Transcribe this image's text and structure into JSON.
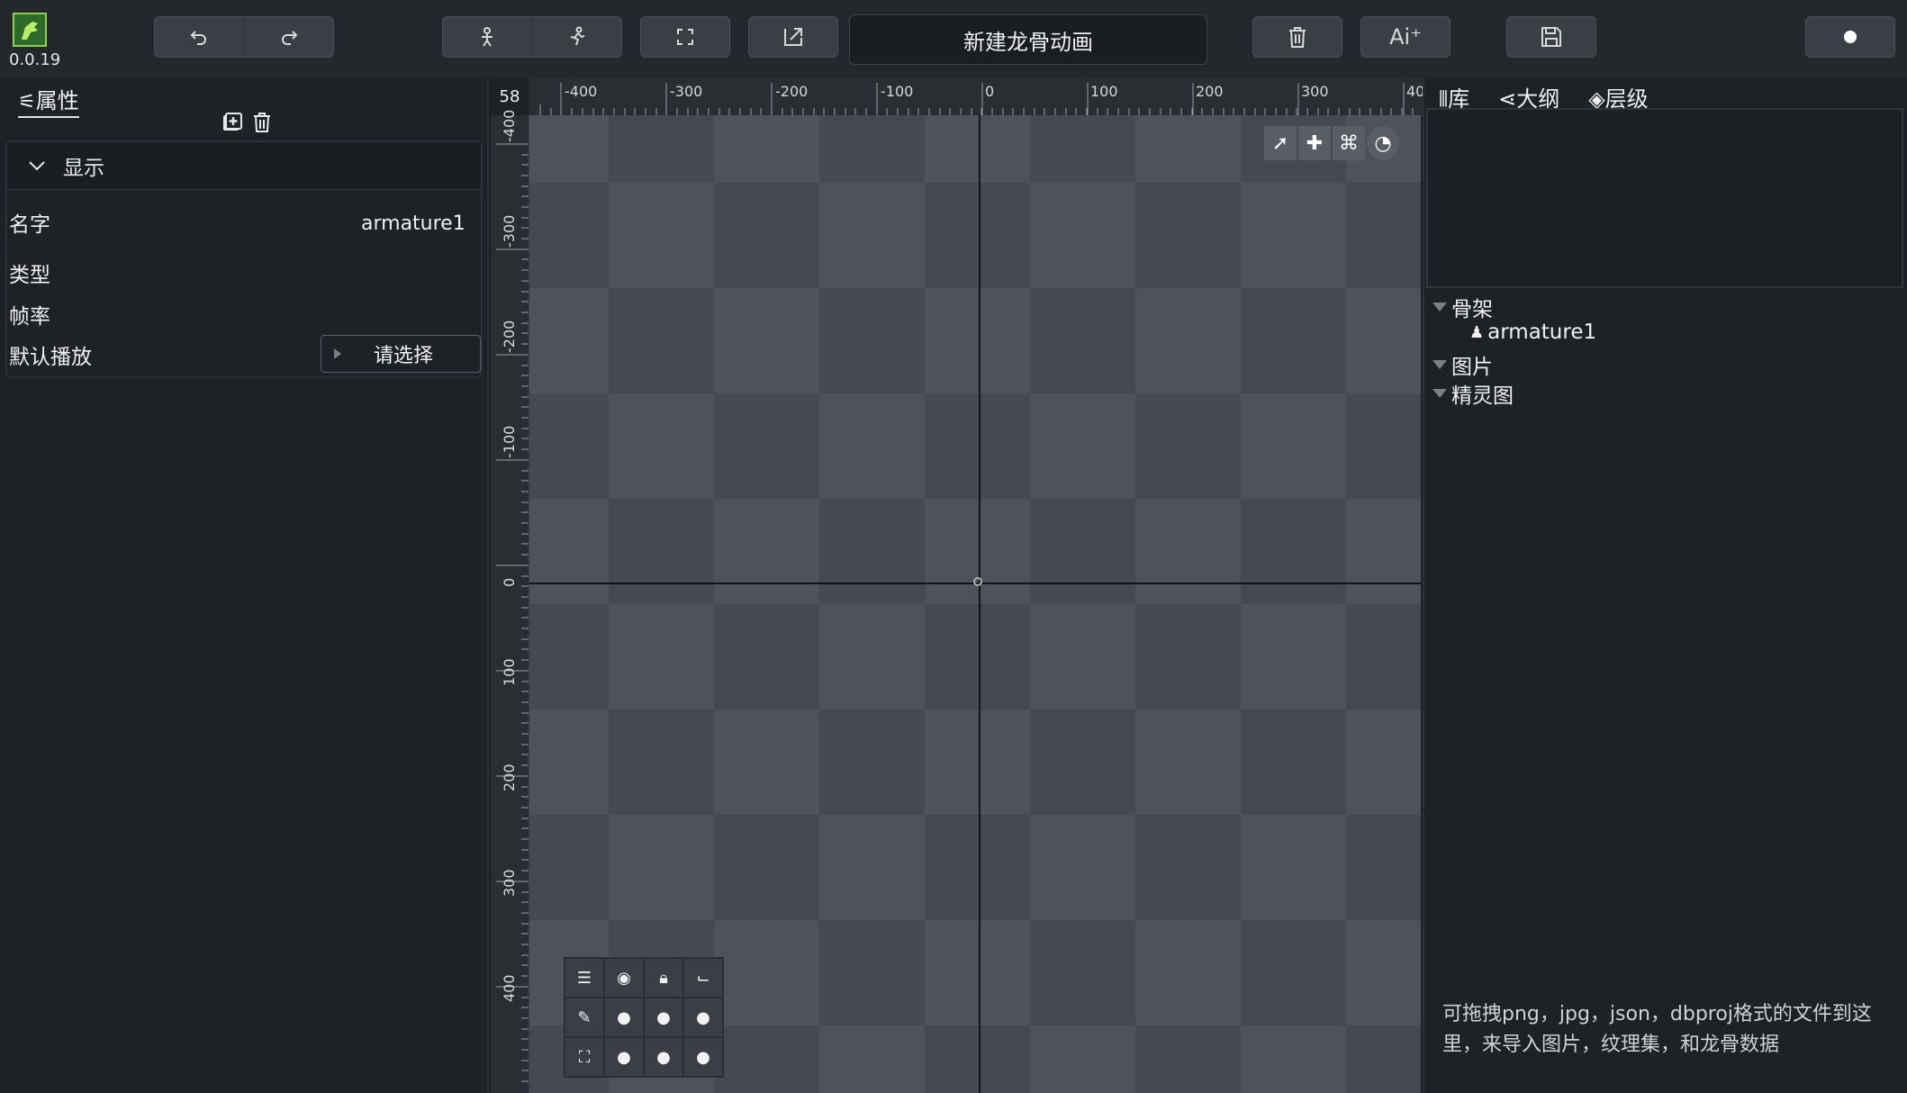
{
  "app": {
    "version": "0.0.19",
    "title": "新建龙骨动画"
  },
  "toolbar": {
    "undo_icon": "undo-icon",
    "redo_icon": "redo-icon",
    "pose_icon": "armature-pose-icon",
    "animate_icon": "run-icon",
    "fit_icon": "fullscreen-icon",
    "export_icon": "export-icon",
    "delete_icon": "trash-icon",
    "ai_label": "Ai⁺",
    "save_icon": "save-icon"
  },
  "left_panel": {
    "tab_label": "属性",
    "section_title": "显示",
    "props": [
      {
        "label": "名字",
        "value": "armature1"
      },
      {
        "label": "类型",
        "value": ""
      },
      {
        "label": "帧率",
        "value": ""
      },
      {
        "label": "默认播放",
        "value": ""
      }
    ],
    "select_label": "请选择"
  },
  "canvas": {
    "zoom_corner": "58",
    "ruler_x": [
      "-400",
      "-300",
      "-200",
      "-100",
      "0",
      "100",
      "200",
      "300",
      "40"
    ],
    "ruler_y": [
      "-400",
      "-300",
      "-200",
      "-100",
      "0",
      "100",
      "200",
      "300",
      "400"
    ]
  },
  "right_panel": {
    "tabs": [
      "库",
      "大纲",
      "层级"
    ],
    "tree": {
      "armature_group": "骨架",
      "armature_item": "armature1",
      "images_group": "图片",
      "sprites_group": "精灵图"
    },
    "hint": "可拖拽png，jpg，json，dbproj格式的文件到这里，来导入图片，纹理集，和龙骨数据"
  },
  "colors": {
    "background": "#1d2024",
    "panel": "#1e2226",
    "button": "#3a3f45",
    "canvas_light": "#4f5258",
    "canvas_dark": "#46494f",
    "logo_green": "#8fd14f"
  }
}
